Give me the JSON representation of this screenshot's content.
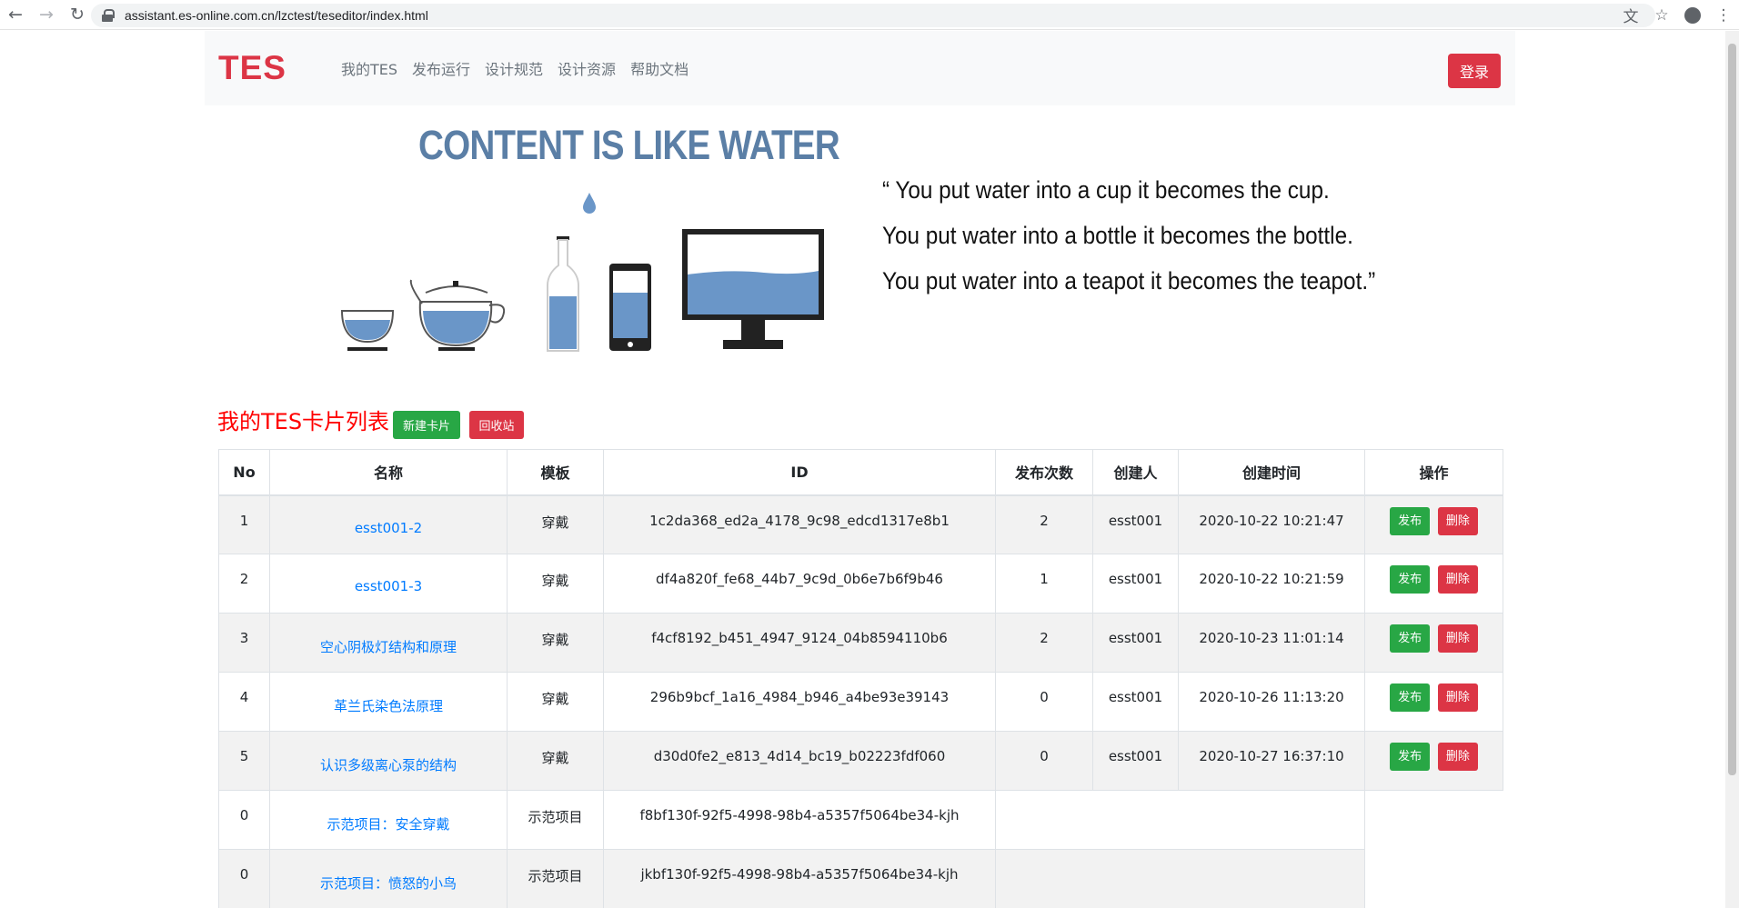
{
  "browser": {
    "url": "assistant.es-online.com.cn/lzctest/teseditor/index.html"
  },
  "navbar": {
    "brand": "TES",
    "links": [
      "我的TES",
      "发布运行",
      "设计规范",
      "设计资源",
      "帮助文档"
    ],
    "login_label": "登录"
  },
  "hero": {
    "title": "CONTENT IS LIKE WATER",
    "quote_lines": [
      "“ You put water into a cup it becomes the cup.",
      "You put water into a bottle it becomes the bottle.",
      "You put water into a teapot it becomes the teapot.”"
    ]
  },
  "card_list": {
    "title": "我的TES卡片列表",
    "new_card_label": "新建卡片",
    "recycle_bin_label": "回收站",
    "columns": [
      "No",
      "名称",
      "模板",
      "ID",
      "发布次数",
      "创建人",
      "创建时间",
      "操作"
    ],
    "publish_label": "发布",
    "delete_label": "删除",
    "rows": [
      {
        "no": "1",
        "name": "esst001-2",
        "template": "穿戴",
        "id": "1c2da368_ed2a_4178_9c98_edcd1317e8b1",
        "count": "2",
        "creator": "esst001",
        "created": "2020-10-22 10:21:47"
      },
      {
        "no": "2",
        "name": "esst001-3",
        "template": "穿戴",
        "id": "df4a820f_fe68_44b7_9c9d_0b6e7b6f9b46",
        "count": "1",
        "creator": "esst001",
        "created": "2020-10-22 10:21:59"
      },
      {
        "no": "3",
        "name": "空心阴极灯结构和原理",
        "template": "穿戴",
        "id": "f4cf8192_b451_4947_9124_04b8594110b6",
        "count": "2",
        "creator": "esst001",
        "created": "2020-10-23 11:01:14"
      },
      {
        "no": "4",
        "name": "革兰氏染色法原理",
        "template": "穿戴",
        "id": "296b9bcf_1a16_4984_b946_a4be93e39143",
        "count": "0",
        "creator": "esst001",
        "created": "2020-10-26 11:13:20"
      },
      {
        "no": "5",
        "name": "认识多级离心泵的结构",
        "template": "穿戴",
        "id": "d30d0fe2_e813_4d14_bc19_b02223fdf060",
        "count": "0",
        "creator": "esst001",
        "created": "2020-10-27 16:37:10"
      }
    ],
    "demo_rows": [
      {
        "no": "0",
        "name": "示范项目：安全穿戴",
        "template": "示范项目",
        "id": "f8bf130f-92f5-4998-98b4-a5357f5064be34-kjh"
      },
      {
        "no": "0",
        "name": "示范项目：愤怒的小鸟",
        "template": "示范项目",
        "id": "jkbf130f-92f5-4998-98b4-a5357f5064be34-kjh"
      }
    ]
  },
  "colors": {
    "brand_red": "#dc3545",
    "success_green": "#28a745",
    "link_blue": "#007bff",
    "water_blue": "#6a96c8"
  }
}
